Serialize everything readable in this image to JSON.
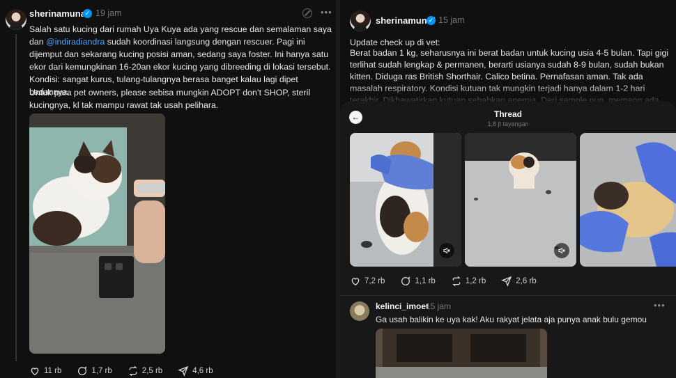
{
  "left_post": {
    "username": "sherinamunaf",
    "time": "19 jam",
    "para1_a": "Salah satu kucing dari rumah Uya Kuya ada yang rescue dan semalaman saya dan ",
    "mention": "@indiradiandra",
    "para1_b": " sudah koordinasi langsung dengan rescuer. Pagi ini dijemput dan sekarang kucing posisi aman, sedang saya foster. Ini hanya satu ekor dari kemungkinan 16-20an ekor kucing yang dibreeding di lokasi tersebut. Kondisi: sangat kurus, tulang-tulangnya berasa banget kalau lagi dipet badannya.",
    "para2": "Untuk para pet owners, please sebisa mungkin ADOPT don’t SHOP, steril kucingnya, kl tak mampu rawat tak usah pelihara.",
    "likes": "11 rb",
    "replies": "1,7 rb",
    "reposts": "2,5 rb",
    "shares": "4,6 rb"
  },
  "right_post": {
    "username": "sherinamunaf",
    "time": "15 jam",
    "text_title": "Update check up di vet:",
    "text_body": "Berat badan 1 kg, seharusnya ini berat badan untuk kucing usia 4-5 bulan. Tapi gigi terlihat sudah lengkap & permanen, berarti usianya sudah 8-9 bulan, sudah bukan kitten. Diduga ras British Shorthair. Calico betina. Pernafasan aman. Tak ada masalah respiratory. Kondisi kutuan tak mungkin terjadi hanya dalam 1-2 hari terakhir. Dikhawatirkan kutuan sebabkan anemia. Dari sample pup, memang ada slight overgrowth bakteri normal, bisa",
    "thread_title": "Thread",
    "thread_views": "1,8 jt tayangan",
    "likes": "7,2 rb",
    "replies": "1,1 rb",
    "reposts": "1,2 rb",
    "shares": "2,6 rb"
  },
  "reply": {
    "username": "kelinci_imoet",
    "time": "15 jam",
    "text": "Ga usah balikin ke uya kak! Aku rakyat jelata aja punya anak bulu gemou"
  },
  "icons": {
    "like": "heart-icon",
    "reply": "comment-icon",
    "repost": "repost-icon",
    "share": "share-icon",
    "mute": "mute-icon",
    "back": "back-arrow-icon",
    "more": "more-icon"
  },
  "colors": {
    "background": "#101010",
    "mention": "#4da3ff",
    "verified": "#0095f6"
  }
}
